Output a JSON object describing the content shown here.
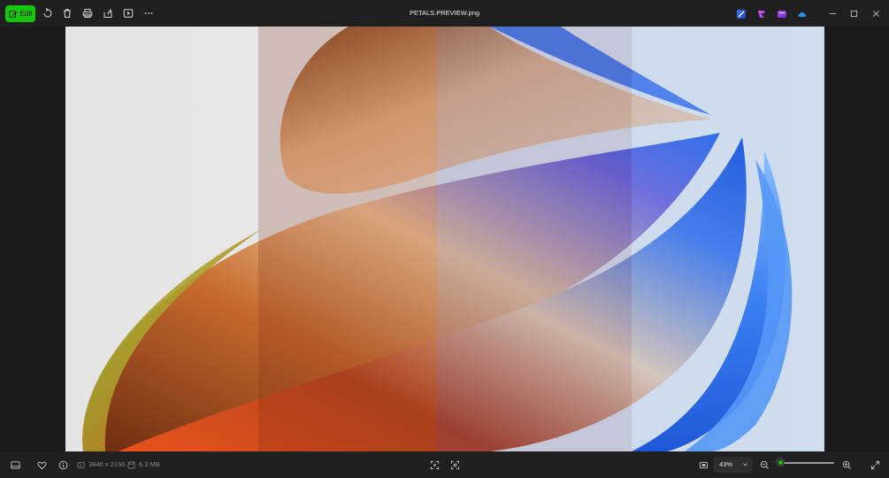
{
  "window": {
    "title": "PETALS.PREVIEW.png"
  },
  "toolbar": {
    "edit_label": "Edit",
    "icons": [
      "rotate-icon",
      "delete-icon",
      "print-icon",
      "share-icon",
      "slideshow-icon",
      "more-icon"
    ]
  },
  "right_apps": [
    "clipchamp-icon",
    "designer-icon",
    "clipchamp-video-icon",
    "onedrive-icon"
  ],
  "status": {
    "dimensions": "3840 x 2160",
    "file_size": "6.3 MB",
    "zoom_value": "43%",
    "zoom_level": 0.05
  },
  "colors": {
    "accent": "#16c60c",
    "background": "#1b1b1b",
    "bar": "#202020"
  }
}
